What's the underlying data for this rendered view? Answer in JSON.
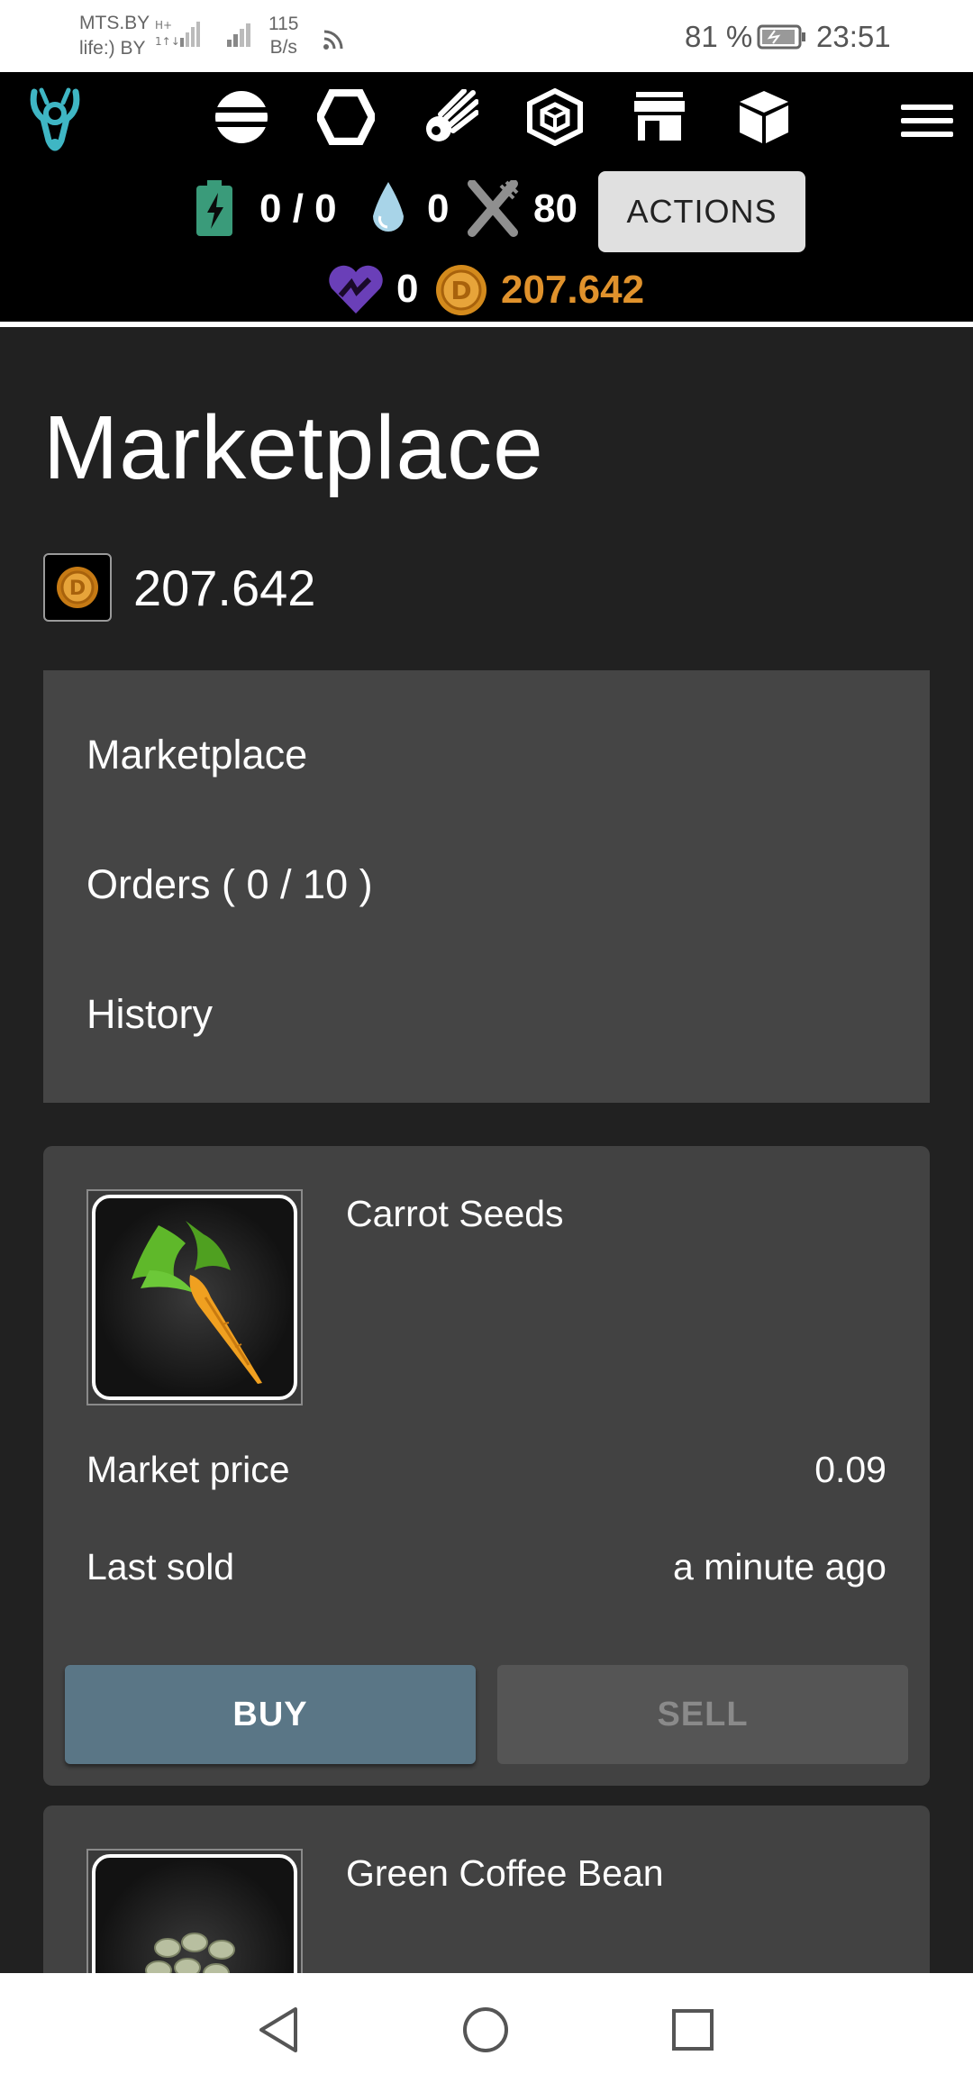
{
  "status_bar": {
    "carrier1": "MTS.BY",
    "carrier2": "life:) BY",
    "speed_value": "115",
    "speed_unit": "B/s",
    "battery_percent": "81 %",
    "time": "23:51"
  },
  "header": {
    "nav_icons": [
      "planet-icon",
      "hexagon-icon",
      "meteor-icon",
      "cube-outline-icon",
      "store-icon",
      "box-icon"
    ],
    "energy": "0 / 0",
    "water": "0",
    "food": "80",
    "actions_label": "ACTIONS",
    "gems": "0",
    "coins": "207.642",
    "coin_color": "#e0922c"
  },
  "page": {
    "title": "Marketplace",
    "balance": "207.642"
  },
  "submenu": {
    "items": [
      "Marketplace",
      "Orders ( 0 / 10 )",
      "History"
    ]
  },
  "listings": [
    {
      "name": "Carrot Seeds",
      "market_price_label": "Market price",
      "market_price": "0.09",
      "last_sold_label": "Last sold",
      "last_sold": "a minute ago",
      "buy_label": "BUY",
      "sell_label": "SELL"
    },
    {
      "name": "Green Coffee Bean"
    }
  ],
  "colors": {
    "background": "#212121",
    "card": "#424242",
    "buy_button": "#5a7686",
    "sell_button": "#555555",
    "accent": "#3fb6c4"
  }
}
